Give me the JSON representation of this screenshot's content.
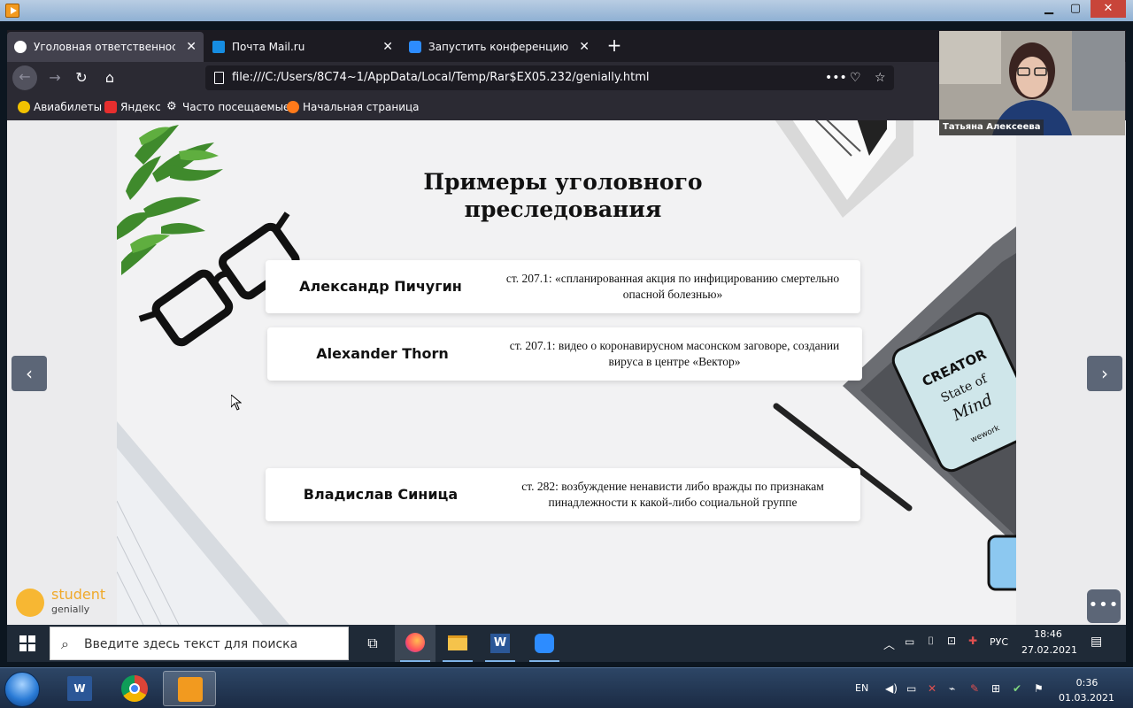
{
  "tabs": [
    {
      "title": "Уголовная ответственность б",
      "active": true
    },
    {
      "title": "Почта Mail.ru",
      "active": false
    },
    {
      "title": "Запустить конференцию - Zo",
      "active": false
    }
  ],
  "address_bar": {
    "url": "file:///C:/Users/8C74~1/AppData/Local/Temp/Rar$EX05.232/genially.html"
  },
  "bookmarks": [
    "Авиабилеты",
    "Яндекс",
    "Часто посещаемые",
    "Начальная страница"
  ],
  "slide": {
    "title": "Примеры уголовного преследования",
    "cards": [
      {
        "name": "Александр Пичугин",
        "desc": "ст. 207.1: «спланированная акция по инфицированию смертельно опасной болезнью»"
      },
      {
        "name": "Alexander Thorn",
        "desc": "ст. 207.1: видео о коронавирусном масонском заговоре, создании вируса в центре «Вектор»"
      },
      {
        "name": "Владислав Синица",
        "desc": "ст. 282: возбуждение ненависти либо вражды по признакам пинадлежности к какой-либо социальной группе"
      }
    ],
    "nav_prev": "‹",
    "nav_next": "›",
    "menu_dots": "•••",
    "logo": {
      "student": "student",
      "brand": "genially"
    },
    "laptop_sticker": "CREATOR State of Mind",
    "laptop_sticker_small": "wework"
  },
  "webcam": {
    "participant": "Татьяна Алексеева"
  },
  "taskbar10": {
    "search_placeholder": "Введите здесь текст для поиска",
    "lang": "РУС",
    "time": "18:46",
    "date": "27.02.2021"
  },
  "taskbar7": {
    "lang": "EN",
    "time": "0:36",
    "date": "01.03.2021"
  },
  "colors": {
    "accent_nav": "#5c6677",
    "genially_yellow": "#f7b733",
    "browser_dark": "#2b2a33"
  }
}
